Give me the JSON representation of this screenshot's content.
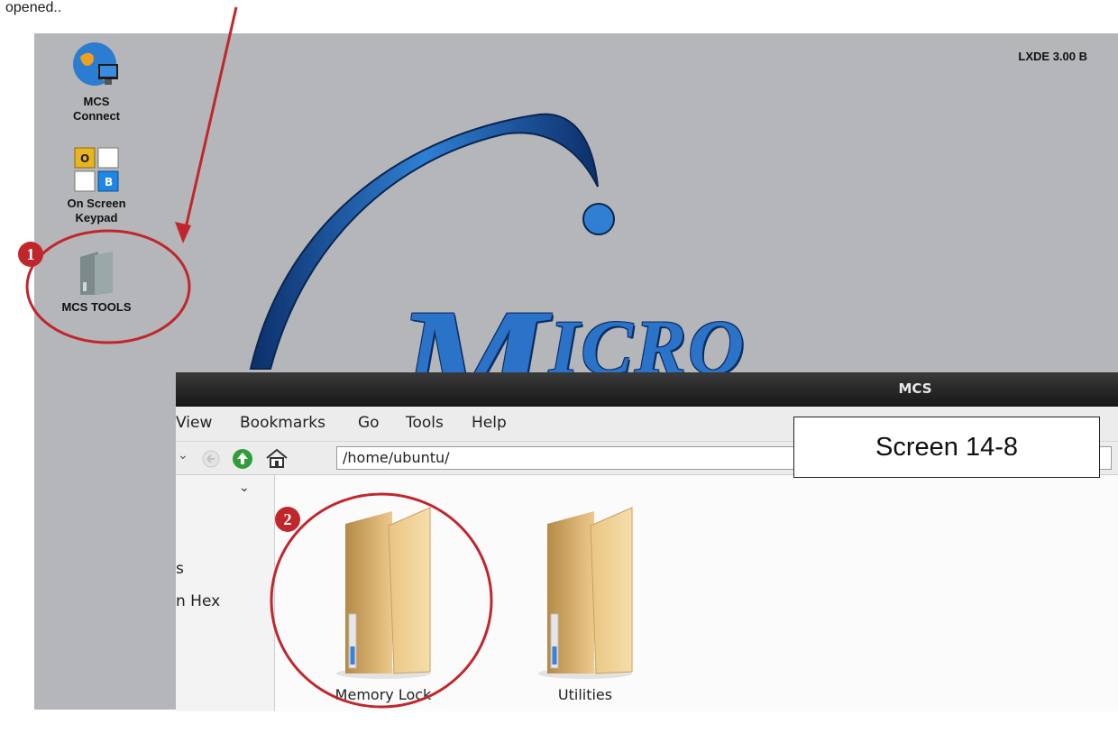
{
  "caption": "opened..",
  "desktop": {
    "version": "LXDE 3.00 B",
    "logo_text": {
      "initial": "M",
      "rest": "ICRO"
    },
    "icons": [
      {
        "label_line1": "MCS",
        "label_line2": "Connect"
      },
      {
        "label_line1": "On Screen",
        "label_line2": "Keypad",
        "keys": [
          "O",
          "B"
        ]
      },
      {
        "label_line1": "MCS TOOLS",
        "label_line2": ""
      }
    ]
  },
  "window": {
    "title": "MCS",
    "menu": [
      "View",
      "Bookmarks",
      "Go",
      "Tools",
      "Help"
    ],
    "address": "/home/ubuntu/",
    "side_items": [
      "s",
      "n Hex"
    ],
    "folders": [
      {
        "label": "Memory Lock"
      },
      {
        "label": "Utilities"
      }
    ]
  },
  "callout": "Screen 14-8",
  "badges": [
    "1",
    "2"
  ],
  "colors": {
    "accent_red": "#c0272d",
    "desktop_bg": "#b5b6b9",
    "logo_blue": "#2a73c8"
  }
}
